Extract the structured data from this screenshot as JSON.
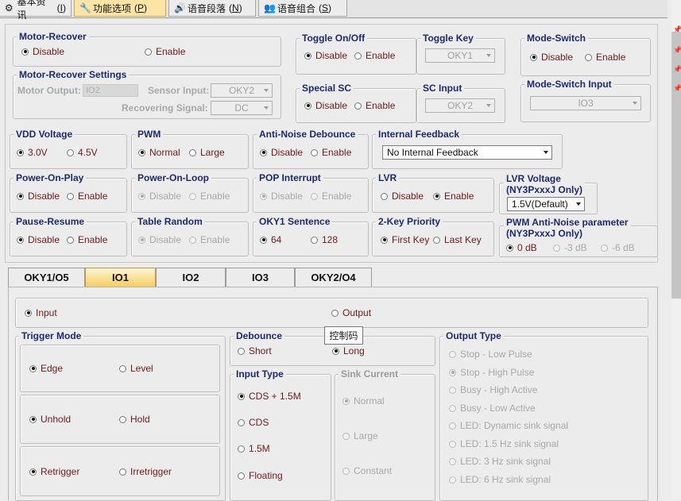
{
  "top_tabs": [
    {
      "label": "基本资讯",
      "key": "I"
    },
    {
      "label": "功能选项",
      "key": "P"
    },
    {
      "label": "语音段落",
      "key": "N"
    },
    {
      "label": "语音组合",
      "key": "S"
    }
  ],
  "motor_recover": {
    "title": "Motor-Recover",
    "disable": "Disable",
    "enable": "Enable"
  },
  "motor_recover_settings": {
    "title": "Motor-Recover Settings",
    "motor_output_label": "Motor Output:",
    "motor_output_value": "IO2",
    "sensor_input_label": "Sensor Input:",
    "sensor_input_value": "OKY2",
    "recovering_signal_label": "Recovering Signal:",
    "recovering_signal_value": "DC"
  },
  "toggle": {
    "title": "Toggle On/Off",
    "disable": "Disable",
    "enable": "Enable"
  },
  "toggle_key": {
    "title": "Toggle Key",
    "value": "OKY1"
  },
  "special_sc": {
    "title": "Special SC",
    "disable": "Disable",
    "enable": "Enable"
  },
  "sc_input": {
    "title": "SC Input",
    "value": "OKY2"
  },
  "mode_switch": {
    "title": "Mode-Switch",
    "disable": "Disable",
    "enable": "Enable"
  },
  "mode_switch_input": {
    "title": "Mode-Switch Input",
    "value": "IO3"
  },
  "vdd": {
    "title": "VDD Voltage",
    "a": "3.0V",
    "b": "4.5V"
  },
  "pwm": {
    "title": "PWM",
    "a": "Normal",
    "b": "Large"
  },
  "anti_noise": {
    "title": "Anti-Noise Debounce",
    "a": "Disable",
    "b": "Enable"
  },
  "internal_feedback": {
    "title": "Internal Feedback",
    "value": "No Internal Feedback"
  },
  "power_on_play": {
    "title": "Power-On-Play",
    "a": "Disable",
    "b": "Enable"
  },
  "power_on_loop": {
    "title": "Power-On-Loop",
    "a": "Disable",
    "b": "Enable"
  },
  "pop_interrupt": {
    "title": "POP Interrupt",
    "a": "Disable",
    "b": "Enable"
  },
  "lvr": {
    "title": "LVR",
    "a": "Disable",
    "b": "Enable"
  },
  "lvr_voltage": {
    "title1": "LVR Voltage",
    "title2": "(NY3PxxxJ Only)",
    "value": "1.5V(Default)"
  },
  "pause_resume": {
    "title": "Pause-Resume",
    "a": "Disable",
    "b": "Enable"
  },
  "table_random": {
    "title": "Table Random",
    "a": "Disable",
    "b": "Enable"
  },
  "oky1_sentence": {
    "title": "OKY1 Sentence",
    "a": "64",
    "b": "128"
  },
  "two_key": {
    "title": "2-Key Priority",
    "a": "First Key",
    "b": "Last Key"
  },
  "pwm_anti": {
    "title1": "PWM Anti-Noise parameter",
    "title2": "(NY3PxxxJ Only)",
    "a": "0 dB",
    "b": "-3 dB",
    "c": "-6 dB"
  },
  "sub_tabs": [
    "OKY1/O5",
    "IO1",
    "IO2",
    "IO3",
    "OKY2/O4"
  ],
  "io_mode": {
    "input": "Input",
    "output": "Output"
  },
  "trigger_mode": {
    "title": "Trigger Mode",
    "edge": "Edge",
    "level": "Level",
    "unhold": "Unhold",
    "hold": "Hold",
    "retrigger": "Retrigger",
    "irretrigger": "Irretrigger"
  },
  "debounce": {
    "title": "Debounce",
    "short": "Short",
    "long": "Long"
  },
  "tooltip": "控制码",
  "input_type": {
    "title": "Input Type",
    "items": [
      "CDS + 1.5M",
      "CDS",
      "1.5M",
      "Floating"
    ]
  },
  "sink_current": {
    "title": "Sink Current",
    "items": [
      "Normal",
      "Large",
      "Constant"
    ]
  },
  "output_type": {
    "title": "Output Type",
    "items": [
      "Stop - Low Pulse",
      "Stop - High Pulse",
      "Busy - High Active",
      "Busy - Low Active",
      "LED: Dynamic sink signal",
      "LED: 1.5 Hz sink signal",
      "LED: 3 Hz sink signal",
      "LED: 6 Hz sink signal"
    ]
  }
}
